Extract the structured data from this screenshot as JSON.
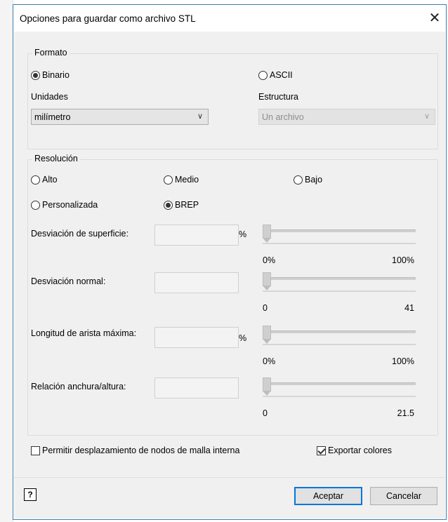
{
  "dialog": {
    "title": "Opciones para guardar como archivo STL",
    "close_glyph": "✕"
  },
  "formato": {
    "legend": "Formato",
    "binario": "Binario",
    "ascii": "ASCII",
    "selected": "Binario",
    "unidades_label": "Unidades",
    "unidades_value": "milímetro",
    "estructura_label": "Estructura",
    "estructura_value": "Un archivo"
  },
  "resolucion": {
    "legend": "Resolución",
    "alto": "Alto",
    "medio": "Medio",
    "bajo": "Bajo",
    "personalizada": "Personalizada",
    "brep": "BREP",
    "selected": "BREP"
  },
  "params": [
    {
      "label": "Desviación de superficie:",
      "unit": "%",
      "min": "0%",
      "max": "100%",
      "value": 0
    },
    {
      "label": "Desviación normal:",
      "unit": "",
      "min": "0",
      "max": "41",
      "value": 0
    },
    {
      "label": "Longitud de arista máxima:",
      "unit": "%",
      "min": "0%",
      "max": "100%",
      "value": 0
    },
    {
      "label": "Relación anchura/altura:",
      "unit": "",
      "min": "0",
      "max": "21.5",
      "value": 0
    }
  ],
  "options": {
    "interna_label": "Permitir desplazamiento de nodos de malla interna",
    "interna_checked": false,
    "colores_label": "Exportar colores",
    "colores_checked": true
  },
  "buttons": {
    "help": "?",
    "accept": "Aceptar",
    "cancel": "Cancelar"
  },
  "icons": {
    "close": "close-icon",
    "chevron": "chevron-down-icon",
    "help": "help-icon"
  }
}
